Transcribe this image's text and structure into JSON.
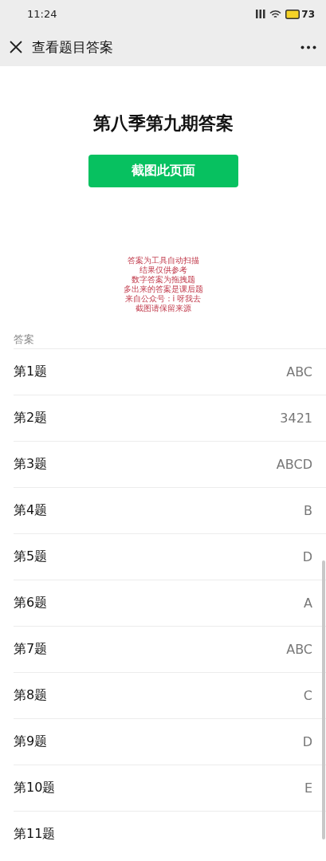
{
  "status_bar": {
    "time": "11:24",
    "battery": "73"
  },
  "nav": {
    "title": "查看题目答案"
  },
  "page": {
    "title": "第八季第九期答案",
    "button": "截图此页面",
    "notice": [
      "答案为工具自动扫描",
      "结果仅供参考",
      "数字答案为拖拽题",
      "多出来的答案是课后题",
      "来自公众号：i 呀我去",
      "截图请保留来源"
    ]
  },
  "section": "答案",
  "rows": [
    {
      "label": "第1题",
      "answer": "ABC"
    },
    {
      "label": "第2题",
      "answer": "3421"
    },
    {
      "label": "第3题",
      "answer": "ABCD"
    },
    {
      "label": "第4题",
      "answer": "B"
    },
    {
      "label": "第5题",
      "answer": "D"
    },
    {
      "label": "第6题",
      "answer": "A"
    },
    {
      "label": "第7题",
      "answer": "ABC"
    },
    {
      "label": "第8题",
      "answer": "C"
    },
    {
      "label": "第9题",
      "answer": "D"
    },
    {
      "label": "第10题",
      "answer": "E"
    },
    {
      "label": "第11题"
    }
  ]
}
